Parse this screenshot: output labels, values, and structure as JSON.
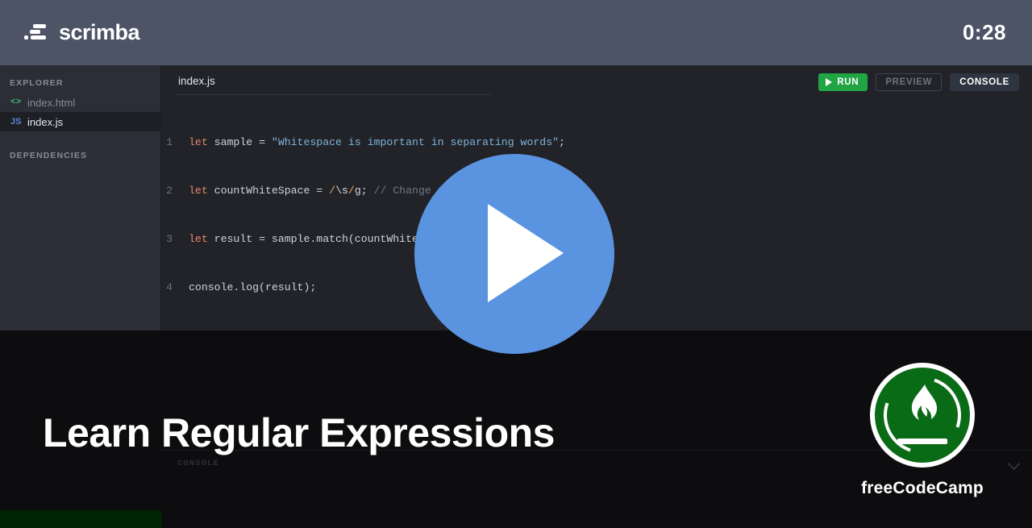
{
  "header": {
    "brand": "scrimba",
    "logo_icon": "scrimba-logo-icon",
    "timer": "0:28"
  },
  "sidebar": {
    "explorer_label": "EXPLORER",
    "dependencies_label": "DEPENDENCIES",
    "files": [
      {
        "name": "index.html",
        "icon": "html-file-icon",
        "icon_glyph": "<>",
        "active": false
      },
      {
        "name": "index.js",
        "icon": "js-file-icon",
        "icon_glyph": "JS",
        "active": true
      }
    ]
  },
  "editor": {
    "tab_label": "index.js",
    "actions": {
      "run_label": "RUN",
      "run_icon": "play-icon",
      "preview_label": "PREVIEW",
      "console_label": "CONSOLE"
    },
    "lines": [
      {
        "num": "1",
        "text": "let sample = \"Whitespace is important in separating words\";"
      },
      {
        "num": "2",
        "text": "let countWhiteSpace = /\\s/g; // Change this line"
      },
      {
        "num": "3",
        "text": "let result = sample.match(countWhiteSpace);"
      },
      {
        "num": "4",
        "text": "console.log(result);"
      }
    ]
  },
  "console_panel": {
    "label": "CONSOLE",
    "collapse_icon": "chevron-down-icon"
  },
  "overlay": {
    "title": "Learn Regular Expressions",
    "play_icon": "play-button-icon",
    "brand_name": "freeCodeCamp",
    "brand_logo_icon": "freecodecamp-flame-icon"
  },
  "colors": {
    "header_bg": "#4c5466",
    "sidebar_bg": "#2b2e37",
    "editor_bg": "#212328",
    "page_bg": "#0d0d0f",
    "run_green": "#21a544",
    "play_blue": "#5a93e0",
    "fcc_green": "#0a6b16",
    "green_strip": "#012503"
  }
}
